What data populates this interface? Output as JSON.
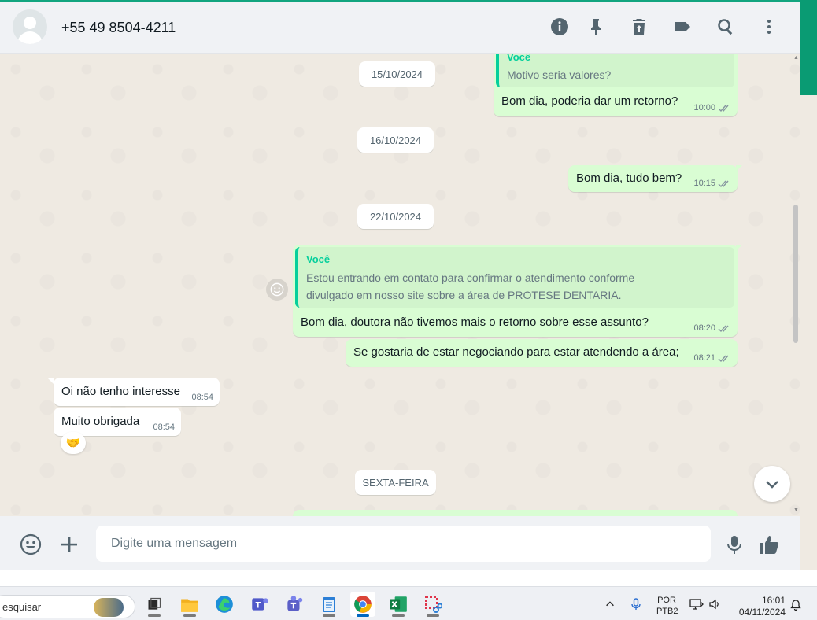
{
  "header": {
    "contact_name": "+55 49 8504-4211",
    "icons": [
      "info-icon",
      "pin-icon",
      "delete-icon",
      "label-icon",
      "search-icon",
      "menu-icon"
    ]
  },
  "colors": {
    "outgoing_bubble": "#d9fdd3",
    "incoming_bubble": "#ffffff",
    "accent": "#06cf9c",
    "brand_green": "#0a9b73"
  },
  "chat": {
    "dates": [
      "15/10/2024",
      "16/10/2024",
      "22/10/2024",
      "SEXTA-FEIRA"
    ],
    "messages": [
      {
        "direction": "out",
        "quote_author": "Você",
        "quote_text": "Motivo seria valores?",
        "text": "Bom dia, poderia dar um retorno?",
        "time": "10:00"
      },
      {
        "direction": "out",
        "text": "Bom dia, tudo bem?",
        "time": "10:15"
      },
      {
        "direction": "out",
        "quote_author": "Você",
        "quote_lines": [
          "Estou entrando em contato para confirmar o atendimento conforme",
          "divulgado em nosso site sobre a área de PROTESE DENTARIA."
        ],
        "text": "Bom dia, doutora não tivemos mais o retorno sobre esse assunto?",
        "time": "08:20"
      },
      {
        "direction": "out",
        "text": "Se gostaria de estar negociando para estar atendendo a área;",
        "time": "08:21"
      },
      {
        "direction": "in",
        "text": "Oi não tenho interesse",
        "time": "08:54"
      },
      {
        "direction": "in",
        "text": "Muito obrigada",
        "time": "08:54",
        "reaction": "🤝"
      }
    ]
  },
  "composer": {
    "placeholder": "Digite uma mensagem"
  },
  "taskbar": {
    "search_text": "esquisar",
    "apps": [
      "task-view",
      "file-explorer",
      "edge",
      "teams-classic",
      "teams",
      "notepad",
      "chrome",
      "excel",
      "snipping-tool"
    ],
    "active_app": "chrome",
    "lang_top": "POR",
    "lang_bottom": "PTB2",
    "time": "16:01",
    "date": "04/11/2024"
  }
}
